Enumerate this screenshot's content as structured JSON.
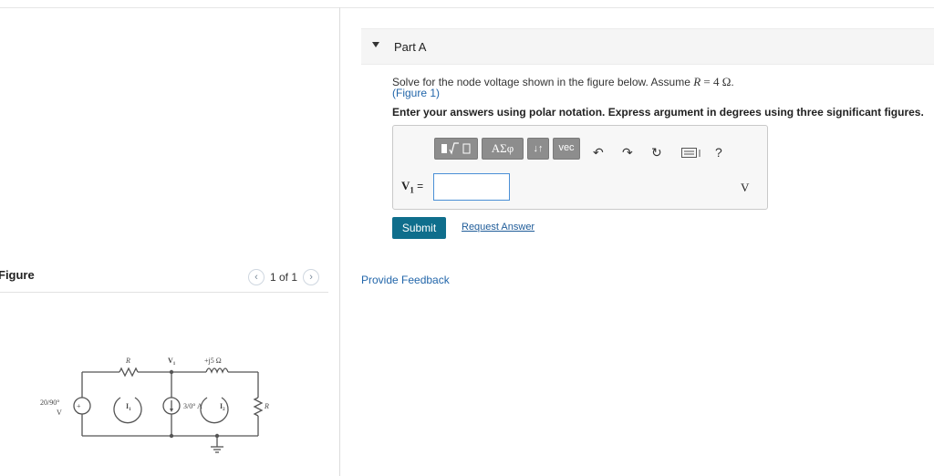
{
  "figure_panel": {
    "title": "Figure",
    "pager_text": "1 of 1",
    "prev_icon": "chevron-left-icon",
    "next_icon": "chevron-right-icon"
  },
  "circuit": {
    "source_label_1": "20/90°",
    "source_label_2": "V",
    "resistor_top": "R",
    "node_label": "V",
    "node_sub": "1",
    "inductor_label": "+j5 Ω",
    "mesh1_label": "I",
    "mesh1_sub": "1",
    "current_source_label": "3/0° A",
    "mesh2_label": "I",
    "mesh2_sub": "2",
    "resistor_right": "R"
  },
  "part": {
    "title": "Part A",
    "problem_prefix": "Solve for the node voltage shown in the figure below. Assume ",
    "problem_var": "R",
    "problem_eq": " = 4 Ω",
    "problem_end": ".",
    "figure_link": "(Figure 1)",
    "instructions": "Enter your answers using polar notation. Express argument in degrees using three significant figures."
  },
  "toolbar": {
    "greek_label": "ΑΣφ",
    "arrows_label": "↓↑",
    "vec_label": "vec",
    "icons": [
      "templates-icon",
      "undo-icon",
      "redo-icon",
      "reset-icon",
      "keyboard-icon",
      "help-icon"
    ],
    "help_label": "?"
  },
  "answer": {
    "var_label": "V",
    "var_sub": "1",
    "equals": "=",
    "value": "",
    "unit": "V"
  },
  "actions": {
    "submit_label": "Submit",
    "request_label": "Request Answer"
  },
  "feedback_label": "Provide Feedback"
}
